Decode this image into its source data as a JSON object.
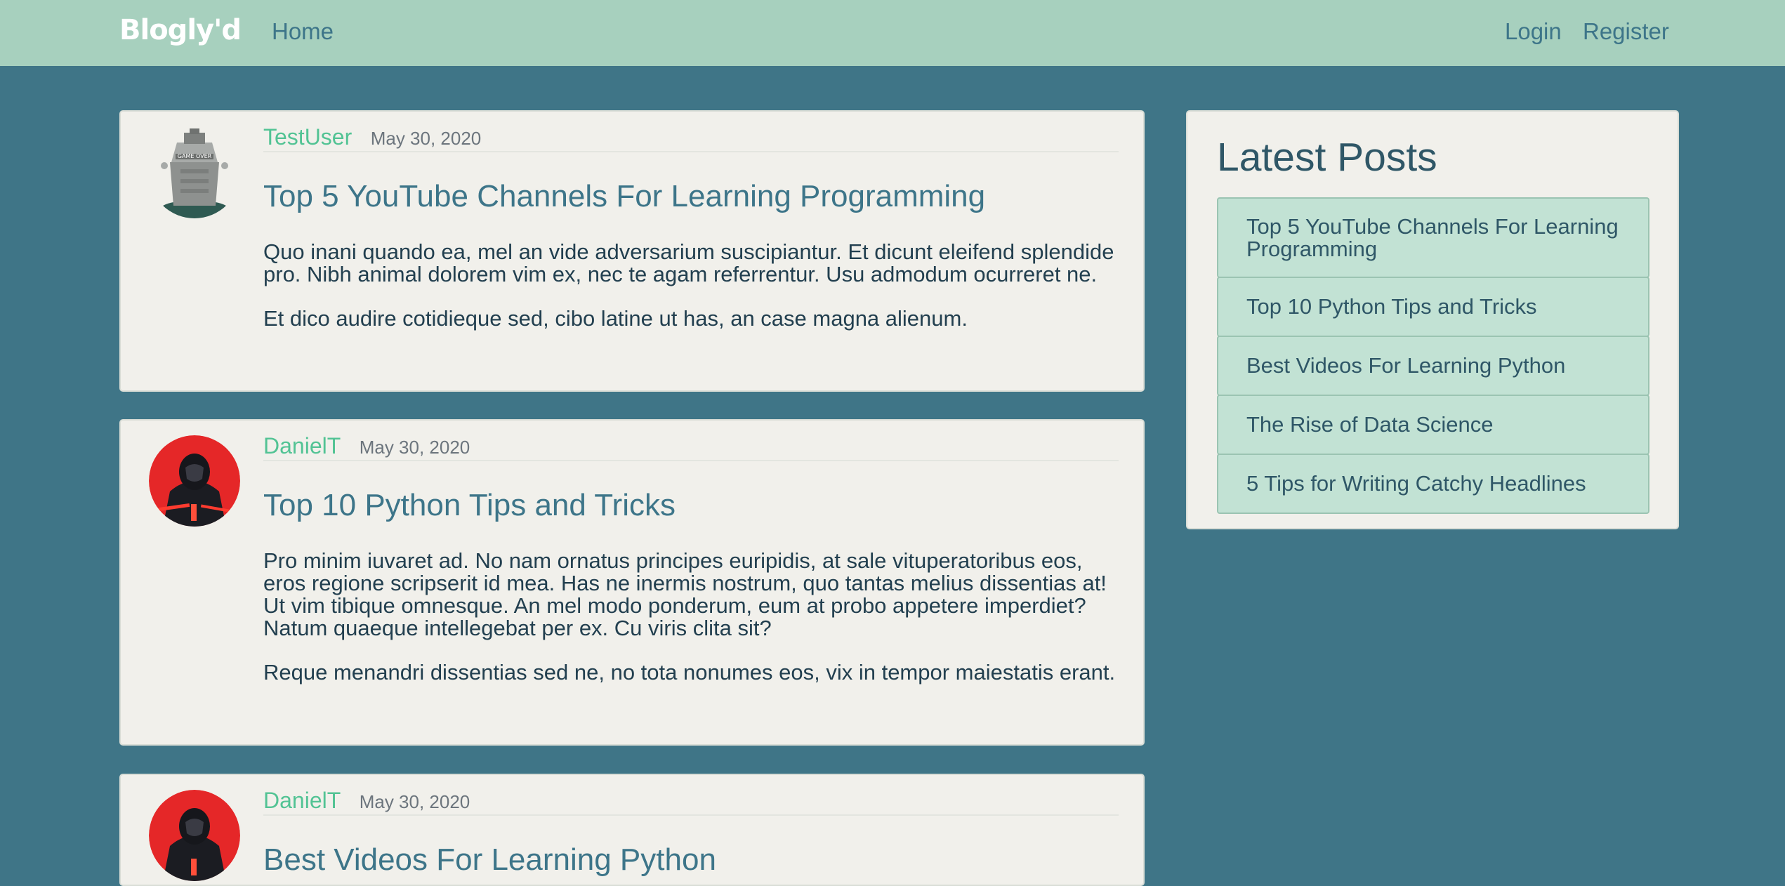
{
  "navbar": {
    "brand": "Blogly'd",
    "home": "Home",
    "login": "Login",
    "register": "Register"
  },
  "posts": [
    {
      "author": "TestUser",
      "date": "May 30, 2020",
      "title": "Top 5 YouTube Channels For Learning Programming",
      "paragraphs": [
        "Quo inani quando ea, mel an vide adversarium suscipiantur. Et dicunt eleifend splendide pro. Nibh animal dolorem vim ex, nec te agam referrentur. Usu admodum ocurreret ne.",
        "Et dico audire cotidieque sed, cibo latine ut has, an case magna alienum."
      ],
      "avatar_label": "GAME OVER"
    },
    {
      "author": "DanielT",
      "date": "May 30, 2020",
      "title": "Top 10 Python Tips and Tricks",
      "paragraphs": [
        "Pro minim iuvaret ad. No nam ornatus principes euripidis, at sale vituperatoribus eos, eros regione scripserit id mea. Has ne inermis nostrum, quo tantas melius dissentias at! Ut vim tibique omnesque. An mel modo ponderum, eum at probo appetere imperdiet? Natum quaeque intellegebat per ex. Cu viris clita sit?",
        "Reque menandri dissentias sed ne, no tota nonumes eos, vix in tempor maiestatis erant."
      ]
    },
    {
      "author": "DanielT",
      "date": "May 30, 2020",
      "title": "Best Videos For Learning Python"
    }
  ],
  "sidebar": {
    "title": "Latest Posts",
    "items": [
      "Top 5 YouTube Channels For Learning Programming",
      "Top 10 Python Tips and Tricks",
      "Best Videos For Learning Python",
      "The Rise of Data Science",
      "5 Tips for Writing Catchy Headlines"
    ]
  },
  "colors": {
    "background": "#3f7587",
    "navbar": "#a7d0be",
    "author": "#52c394",
    "title": "#3d7589",
    "list_item": "#c2e2d4"
  }
}
